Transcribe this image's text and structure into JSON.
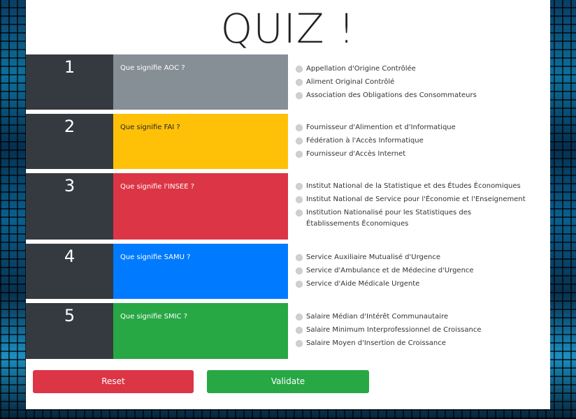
{
  "quiz": {
    "title": "QUIZ !",
    "questions": [
      {
        "number": "1",
        "text": "Que signifie AOC ?",
        "color": "#868e96",
        "text_color": "#ffffff",
        "options": [
          "Appellation d'Origine Contrôlée",
          "Aliment Original Contrôlé",
          "Association des Obligations des Consommateurs"
        ]
      },
      {
        "number": "2",
        "text": "Que signifie FAI ?",
        "color": "#ffc107",
        "text_color": "#212529",
        "options": [
          "Fournisseur d'Alimention et d'Informatique",
          "Fédération à l'Accès Informatique",
          "Fournisseur d'Accès Internet"
        ]
      },
      {
        "number": "3",
        "text": "Que signifie l'INSEE ?",
        "color": "#dc3545",
        "text_color": "#ffffff",
        "options": [
          "Institut National de la Statistique et des Études Économiques",
          "Institut National de Service pour l'Économie et l'Enseignement",
          "Institution Nationalisé pour les Statistiques des Établissements Économiques"
        ]
      },
      {
        "number": "4",
        "text": "Que signifie SAMU ?",
        "color": "#007bff",
        "text_color": "#ffffff",
        "options": [
          "Service Auxiliaire Mutualisé d'Urgence",
          "Service d'Ambulance et de Médecine d'Urgence",
          "Service d'Aide Médicale Urgente"
        ]
      },
      {
        "number": "5",
        "text": "Que signifie SMIC ?",
        "color": "#28a745",
        "text_color": "#ffffff",
        "options": [
          "Salaire Médian d'Intérêt Communautaire",
          "Salaire Minimum Interprofessionnel de Croissance",
          "Salaire Moyen d'Insertion de Croissance"
        ]
      }
    ],
    "reset_label": "Reset",
    "validate_label": "Validate",
    "reset_color": "#dc3545",
    "validate_color": "#28a745"
  }
}
